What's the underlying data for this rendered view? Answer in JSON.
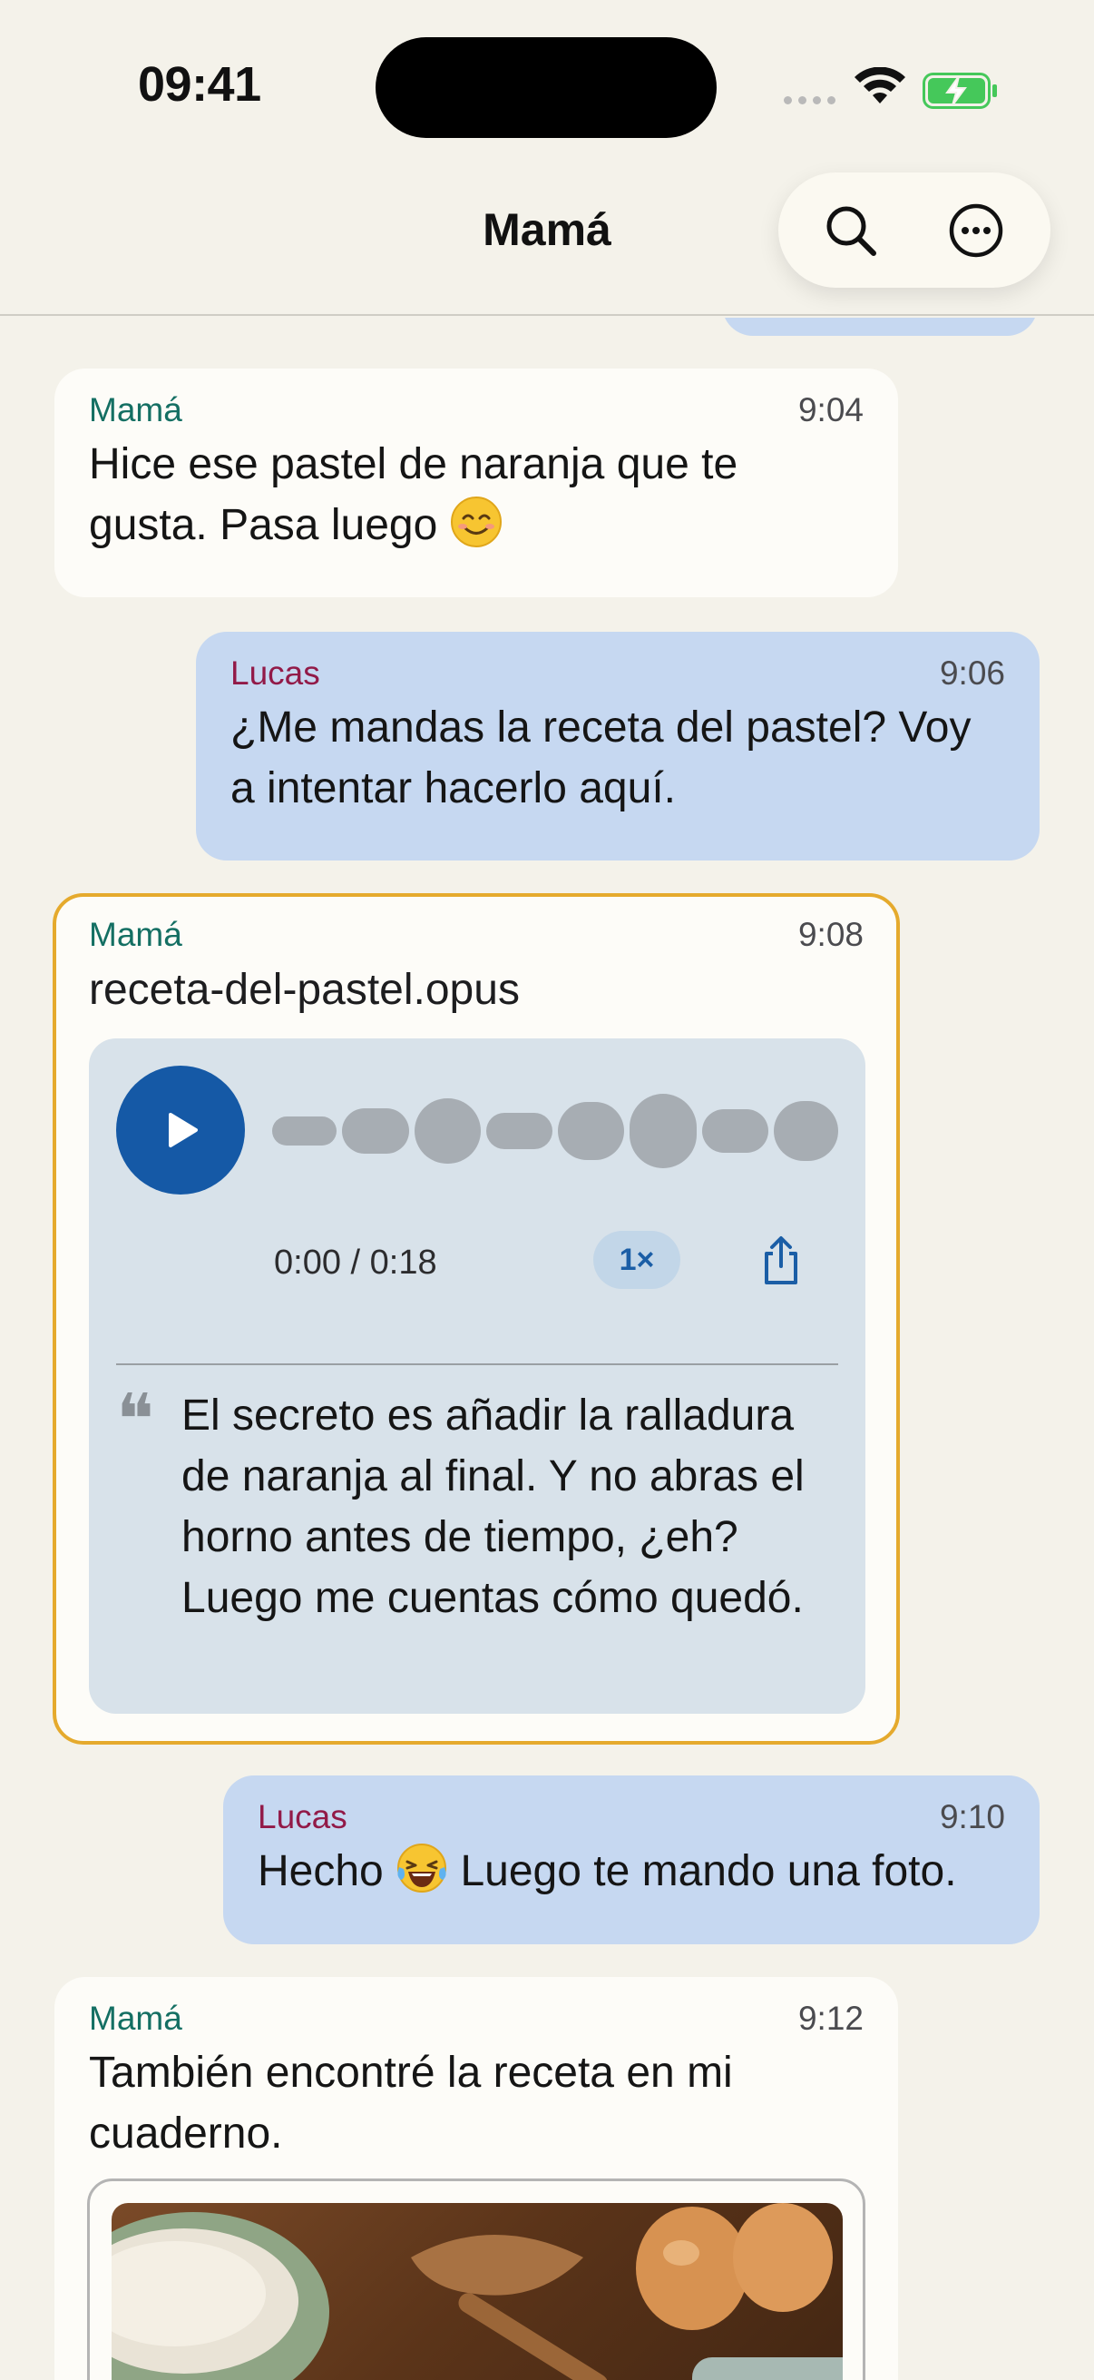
{
  "status_bar": {
    "time": "09:41"
  },
  "header": {
    "title": "Mamá"
  },
  "icons": {
    "search": "search-icon",
    "more": "more-icon",
    "play": "play-icon",
    "share": "share-icon",
    "quote": "quote-icon",
    "wifi": "wifi-icon",
    "battery": "battery-charging-icon"
  },
  "colors": {
    "background": "#f4f2ea",
    "incoming_bubble": "#fdfcf8",
    "outgoing_bubble": "#c6d8f1",
    "mama_name": "#146f63",
    "lucas_name": "#921a48",
    "highlight_border": "#e5aa2d",
    "play_button": "#1559a6",
    "voice_card": "#d8e2ea"
  },
  "messages": [
    {
      "sender": "Mamá",
      "time": "9:04",
      "text": "Hice ese pastel de naranja que te gusta. Pasa luego",
      "emoji": "smiling-face"
    },
    {
      "sender": "Lucas",
      "time": "9:06",
      "text": "¿Me mandas la receta del pastel? Voy a intentar hacerlo aquí."
    },
    {
      "sender": "Mamá",
      "time": "9:08",
      "filename": "receta-del-pastel.opus",
      "duration": "0:00 / 0:18",
      "speed": "1×",
      "transcript": "El secreto es añadir la ralladura de naranja al final. Y no abras el horno antes de tiempo, ¿eh? Luego me cuentas cómo quedó."
    },
    {
      "sender": "Lucas",
      "time": "9:10",
      "text_before": "Hecho",
      "text_after": "Luego te mando una foto.",
      "emoji": "laughing-crying-face"
    },
    {
      "sender": "Mamá",
      "time": "9:12",
      "text": "También encontré la receta en mi cuaderno."
    }
  ]
}
